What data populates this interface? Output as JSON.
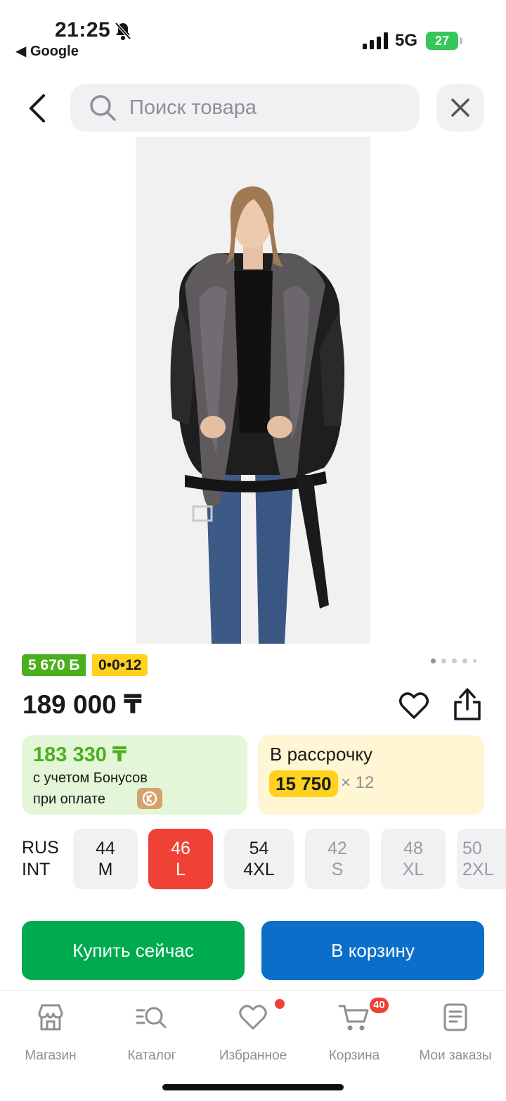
{
  "status_bar": {
    "time": "21:25",
    "back_app": "◀ Google",
    "network": "5G",
    "battery": "27"
  },
  "header": {
    "search_placeholder": "Поиск товара"
  },
  "product": {
    "image_count": 5,
    "current_image": 1,
    "bonus_badge": "5 670 Б",
    "installment_badge": "0•0•12",
    "price": "189 000 ₸",
    "bonus_card": {
      "amount": "183 330 ₸",
      "line1": "с учетом Бонусов",
      "line2": "при оплате"
    },
    "installment_card": {
      "title": "В рассрочку",
      "monthly": "15 750",
      "months": "× 12"
    }
  },
  "sizes": {
    "label_rus": "RUS",
    "label_int": "INT",
    "items": [
      {
        "rus": "44",
        "int": "M",
        "state": "available"
      },
      {
        "rus": "46",
        "int": "L",
        "state": "selected"
      },
      {
        "rus": "54",
        "int": "4XL",
        "state": "available"
      },
      {
        "rus": "42",
        "int": "S",
        "state": "unavailable"
      },
      {
        "rus": "48",
        "int": "XL",
        "state": "unavailable"
      },
      {
        "rus": "50",
        "int": "2XL",
        "state": "unavailable"
      }
    ]
  },
  "actions": {
    "buy_now": "Купить сейчас",
    "add_to_cart": "В корзину"
  },
  "tab_bar": {
    "tabs": [
      {
        "label": "Магазин",
        "icon": "store-icon"
      },
      {
        "label": "Каталог",
        "icon": "catalog-search-icon"
      },
      {
        "label": "Избранное",
        "icon": "heart-icon"
      },
      {
        "label": "Корзина",
        "icon": "cart-icon"
      },
      {
        "label": "Мои заказы",
        "icon": "orders-icon"
      }
    ],
    "cart_count": "40"
  },
  "colors": {
    "accent_green": "#00aa4f",
    "accent_blue": "#0b6fca",
    "selected_size": "#ef4136",
    "bonus_green": "#4caf1d",
    "installment_yellow": "#ffd21f"
  }
}
